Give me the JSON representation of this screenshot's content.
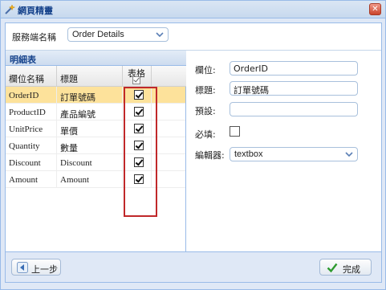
{
  "window": {
    "title": "網頁精靈"
  },
  "service": {
    "label": "服務端名稱",
    "selected": "Order Details"
  },
  "detail_panel": {
    "title": "明細表"
  },
  "grid": {
    "columns": {
      "field_name": "欄位名稱",
      "caption": "標題",
      "table": "表格"
    },
    "rows": [
      {
        "field": "OrderID",
        "caption": "訂單號碼",
        "checked": true,
        "selected": true
      },
      {
        "field": "ProductID",
        "caption": "產品編號",
        "checked": true,
        "selected": false
      },
      {
        "field": "UnitPrice",
        "caption": "單價",
        "checked": true,
        "selected": false
      },
      {
        "field": "Quantity",
        "caption": "數量",
        "checked": true,
        "selected": false
      },
      {
        "field": "Discount",
        "caption": "Discount",
        "checked": true,
        "selected": false
      },
      {
        "field": "Amount",
        "caption": "Amount",
        "checked": true,
        "selected": false
      }
    ]
  },
  "properties": {
    "field_label": "欄位:",
    "field_value": "OrderID",
    "caption_label": "標題:",
    "caption_value": "訂單號碼",
    "default_label": "預設:",
    "default_value": "",
    "required_label": "必填:",
    "required_checked": false,
    "editor_label": "編輯器:",
    "editor_value": "textbox"
  },
  "buttons": {
    "back": "上一步",
    "finish": "完成"
  },
  "colors": {
    "highlight": "#c0282a",
    "selected_row": "#fde29b",
    "title_text": "#15428b"
  }
}
